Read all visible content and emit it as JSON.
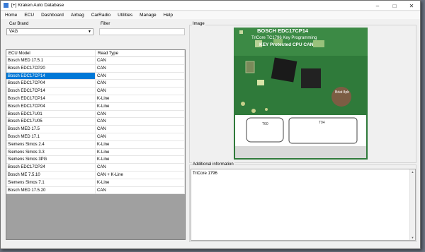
{
  "window": {
    "title": "[+] Kraken Auto Database"
  },
  "menu": [
    "Home",
    "ECU",
    "Dashboard",
    "Airbag",
    "CarRadio",
    "Utilities",
    "Manage",
    "Help"
  ],
  "car_brand": {
    "label": "Car Brand",
    "value": "VAG"
  },
  "filter": {
    "label": "Filter",
    "value": ""
  },
  "table": {
    "headers": [
      "ECU Model",
      "Read Type"
    ],
    "selected_index": 2,
    "rows": [
      [
        "Bosch MED 17.5.1",
        "CAN"
      ],
      [
        "Bosch EDC17CP20",
        "CAN"
      ],
      [
        "Bosch EDC17CP14",
        "CAN"
      ],
      [
        "Bosch EDC17CP04",
        "CAN"
      ],
      [
        "Bosch EDC17CP14",
        "CAN"
      ],
      [
        "Bosch EDC17CP14",
        "K-Line"
      ],
      [
        "Bosch EDC17CP04",
        "K-Line"
      ],
      [
        "Bosch EDC17U01",
        "CAN"
      ],
      [
        "Bosch EDC17U05",
        "CAN"
      ],
      [
        "Bosch MED 17.5",
        "CAN"
      ],
      [
        "Bosch MED 17.1",
        "CAN"
      ],
      [
        "Siemens Simos 2.4",
        "K-Line"
      ],
      [
        "Siemens Simos 3.3",
        "K-Line"
      ],
      [
        "Siemens Simos 3PG",
        "K-Line"
      ],
      [
        "Bosch EDC17CP24",
        "CAN"
      ],
      [
        "Bosch ME 7.5.10",
        "CAN + K-Line"
      ],
      [
        "Siemens Simos 7.1",
        "K-Line"
      ],
      [
        "Bosch MED 17.5.20",
        "CAN"
      ]
    ]
  },
  "image_panel": {
    "label": "Image",
    "heading1": "BOSCH EDC17CP14",
    "heading2": "TriCore TC1796 Key Programming",
    "heading3": "KEY Protected CPU CAN",
    "connector1": "T60",
    "connector2": "T94",
    "colors": {
      "board": "#2f7a3a",
      "title": "#ffffff"
    }
  },
  "additional_info": {
    "label": "Additional information",
    "text": "TriCore 1796"
  },
  "icons": [
    "app-icon",
    "minimize-icon",
    "maximize-icon",
    "close-icon",
    "dropdown-arrow-icon",
    "scroll-up-icon",
    "scroll-down-icon"
  ]
}
